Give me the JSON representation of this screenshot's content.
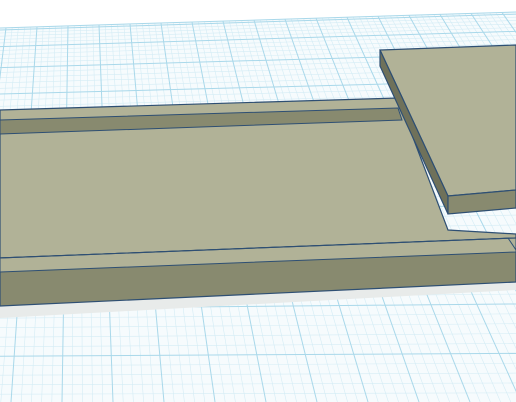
{
  "workplane": {
    "background": "#ffffff",
    "grid_minor_color": "#d4ecf5",
    "grid_major_color": "#a9d8ea"
  },
  "shapes": {
    "top_face_color": "#b1b297",
    "side_face_color": "#888a6f",
    "dark_side_color": "#6f715a",
    "edge_color": "#2e4f73",
    "shadow_color": "#e8ebea"
  },
  "objects": [
    {
      "id": "base-plate",
      "label": "Box"
    },
    {
      "id": "raised-panel",
      "label": "Box"
    }
  ]
}
